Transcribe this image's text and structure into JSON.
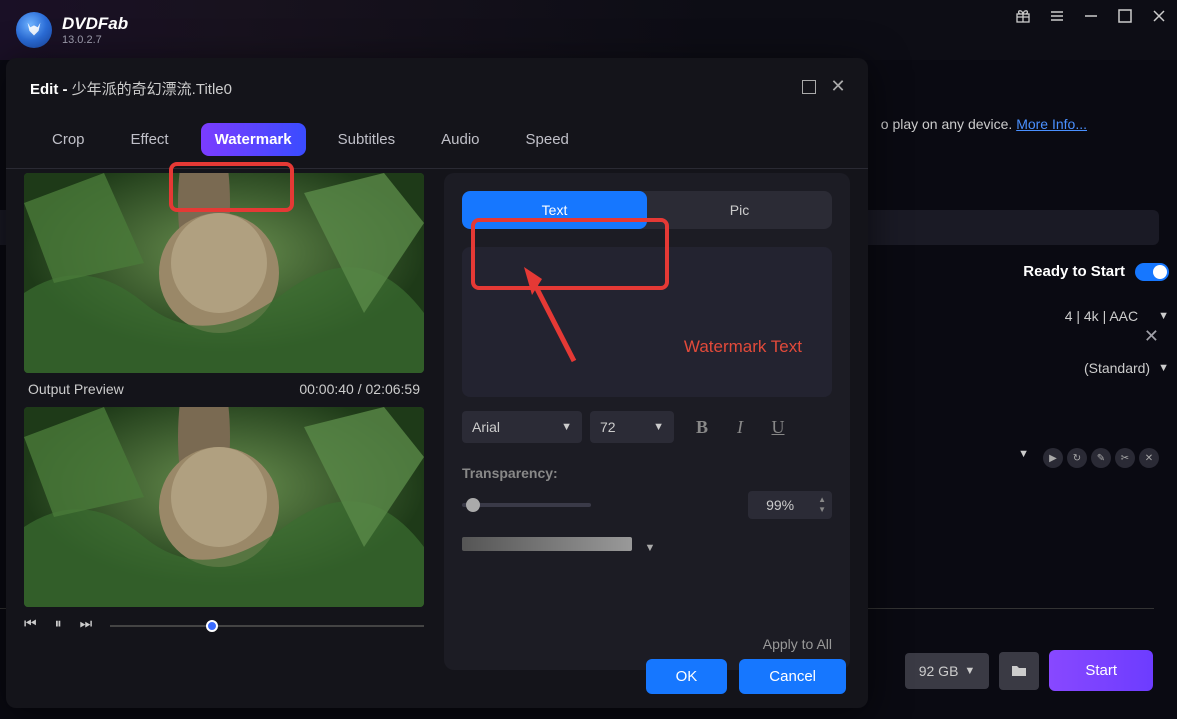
{
  "app": {
    "name": "DVDFab",
    "version": "13.0.2.7"
  },
  "bg": {
    "play_text": "o play on any device. ",
    "more_info": "More Info...",
    "ready": "Ready to Start",
    "codec": "4 | 4k | AAC",
    "mode": "(Standard)",
    "gb": "92 GB",
    "start": "Start"
  },
  "dialog": {
    "title_prefix": "Edit - ",
    "title_file": "少年派的奇幻漂流.Title0",
    "tabs": [
      "Crop",
      "Effect",
      "Watermark",
      "Subtitles",
      "Audio",
      "Speed"
    ],
    "active_tab": 2,
    "output_label": "Output Preview",
    "timecode": "00:00:40 / 02:06:59",
    "wm": {
      "seg": [
        "Text",
        "Pic"
      ],
      "active_seg": 0,
      "placeholder": "Watermark Text",
      "font": "Arial",
      "size": "72",
      "transparency_label": "Transparency:",
      "transparency_value": "99%",
      "apply": "Apply to All"
    },
    "ok": "OK",
    "cancel": "Cancel"
  }
}
